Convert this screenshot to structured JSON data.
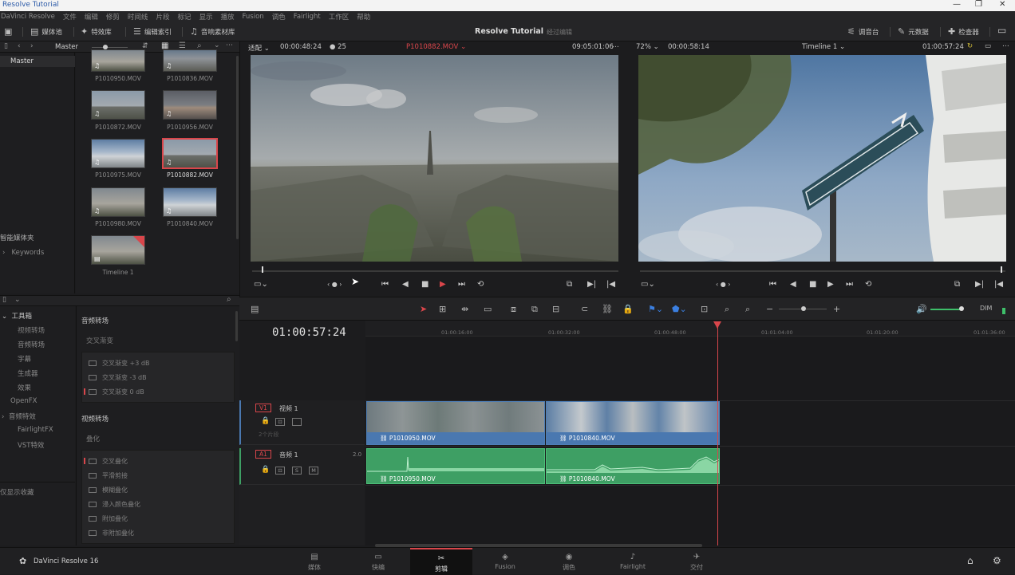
{
  "titlebar": {
    "title": "Resolve Tutorial",
    "min": "—",
    "max": "❐",
    "close": "✕"
  },
  "menu": [
    "DaVinci Resolve",
    "文件",
    "编辑",
    "修剪",
    "时间线",
    "片段",
    "标记",
    "显示",
    "播放",
    "Fusion",
    "调色",
    "Fairlight",
    "工作区",
    "帮助"
  ],
  "toolbar": {
    "left": [
      {
        "icon": "▣",
        "label": ""
      },
      {
        "icon": "▤",
        "label": "媒体池"
      },
      {
        "icon": "✦",
        "label": "特效库"
      },
      {
        "icon": "☰",
        "label": "编辑索引"
      },
      {
        "icon": "♫",
        "label": "音响素材库"
      }
    ],
    "project_title": "Resolve Tutorial",
    "project_sub": "经过编辑",
    "right": [
      {
        "icon": "⚟",
        "label": "调音台"
      },
      {
        "icon": "✎",
        "label": "元数据"
      },
      {
        "icon": "✚",
        "label": "检查器"
      }
    ]
  },
  "media_pool": {
    "bin_label": "Master",
    "bins": [
      "Master"
    ],
    "smart_bins_label": "智能媒体夹",
    "keywords_label": "Keywords",
    "clips": [
      {
        "name": "P1010950.MOV",
        "style": "sky3"
      },
      {
        "name": "P1010836.MOV",
        "style": "sky5"
      },
      {
        "name": "P1010872.MOV",
        "style": "sky1"
      },
      {
        "name": "P1010956.MOV",
        "style": "sky4"
      },
      {
        "name": "P1010975.MOV",
        "style": "sky2"
      },
      {
        "name": "P1010882.MOV",
        "style": "sky1"
      },
      {
        "name": "P1010980.MOV",
        "style": "sky3"
      },
      {
        "name": "P1010840.MOV",
        "style": "sky2"
      },
      {
        "name": "Timeline 1",
        "style": "sky3"
      }
    ]
  },
  "effects": {
    "toolbox": {
      "title": "工具箱",
      "items": [
        "视频转场",
        "音频转场",
        "字幕",
        "生成器",
        "效果"
      ],
      "openfx": "OpenFX",
      "audio_fx": "音频特效",
      "audio_items": [
        "FairlightFX",
        "VST特效"
      ],
      "favorites": "仅显示收藏"
    },
    "video_trans_head": "音频转场",
    "cross_fade_sub": "交叉渐变",
    "audio_items": [
      "交叉渐变 +3 dB",
      "交叉渐变 -3 dB",
      "交叉渐变 0 dB"
    ],
    "video_head": "视频转场",
    "dissolve_sub": "叠化",
    "video_items": [
      "交叉叠化",
      "平滑剪接",
      "模糊叠化",
      "浸入颜色叠化",
      "附加叠化",
      "非附加叠化"
    ]
  },
  "source_viewer": {
    "fit": "适配",
    "timecode": "00:00:48:24",
    "fps": "25",
    "clip": "P1010882.MOV",
    "tc_right": "09:05:01:06"
  },
  "timeline_viewer": {
    "zoom": "72%",
    "timecode": "00:00:58:14",
    "name": "Timeline 1",
    "tc_right": "01:00:57:24"
  },
  "timeline": {
    "current_tc": "01:00:57:24",
    "ruler": [
      "01:00:16:00",
      "01:00:32:00",
      "01:00:48:00",
      "01:01:04:00",
      "01:01:20:00",
      "01:01:36:00"
    ],
    "video_track": {
      "id": "V1",
      "name": "视频 1",
      "clip_count": "2个片段"
    },
    "audio_track": {
      "id": "A1",
      "name": "音频 1",
      "level": "2.0",
      "btn_s": "S",
      "btn_m": "M"
    },
    "clips": [
      {
        "name": "P1010950.MOV"
      },
      {
        "name": "P1010840.MOV"
      }
    ]
  },
  "pages": [
    {
      "icon": "▤",
      "label": "媒体"
    },
    {
      "icon": "▭",
      "label": "快编"
    },
    {
      "icon": "✂",
      "label": "剪辑"
    },
    {
      "icon": "◈",
      "label": "Fusion"
    },
    {
      "icon": "◉",
      "label": "调色"
    },
    {
      "icon": "♪",
      "label": "Fairlight"
    },
    {
      "icon": "✈",
      "label": "交付"
    }
  ],
  "active_page": "剪辑",
  "app_brand": "DaVinci Resolve 16",
  "colors": {
    "accent": "#d9464b",
    "video_clip": "#4a78b0",
    "audio_clip": "#3e9f64"
  }
}
